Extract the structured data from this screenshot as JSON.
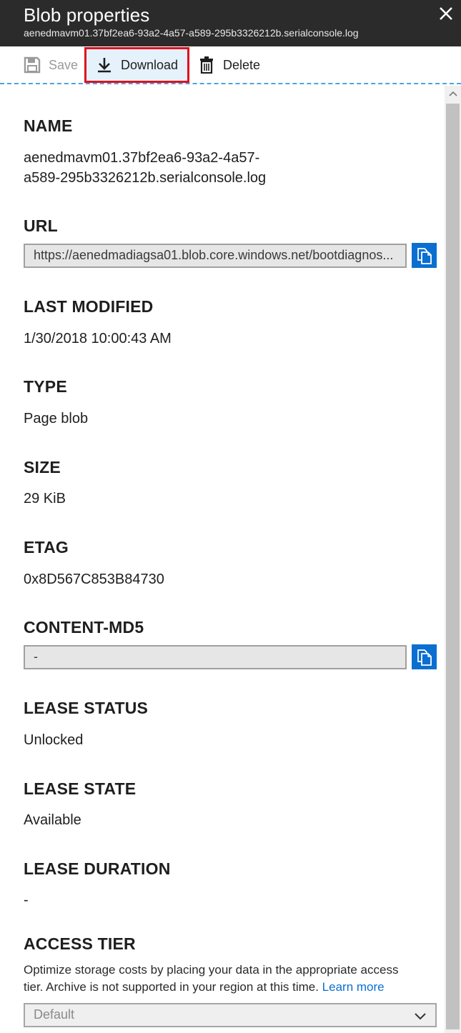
{
  "header": {
    "title": "Blob properties",
    "subtitle": "aenedmavm01.37bf2ea6-93a2-4a57-a589-295b3326212b.serialconsole.log"
  },
  "toolbar": {
    "save_label": "Save",
    "download_label": "Download",
    "delete_label": "Delete"
  },
  "properties": {
    "name": {
      "label": "NAME",
      "value_line1": "aenedmavm01.37bf2ea6-93a2-4a57-",
      "value_line2": "a589-295b3326212b.serialconsole.log"
    },
    "url": {
      "label": "URL",
      "value": "https://aenedmadiagsa01.blob.core.windows.net/bootdiagnos..."
    },
    "last_modified": {
      "label": "LAST MODIFIED",
      "value": "1/30/2018 10:00:43 AM"
    },
    "type": {
      "label": "TYPE",
      "value": "Page blob"
    },
    "size": {
      "label": "SIZE",
      "value": "29 KiB"
    },
    "etag": {
      "label": "ETAG",
      "value": "0x8D567C853B84730"
    },
    "content_md5": {
      "label": "CONTENT-MD5",
      "value": "-"
    },
    "lease_status": {
      "label": "LEASE STATUS",
      "value": "Unlocked"
    },
    "lease_state": {
      "label": "LEASE STATE",
      "value": "Available"
    },
    "lease_duration": {
      "label": "LEASE DURATION",
      "value": "-"
    },
    "access_tier": {
      "label": "ACCESS TIER",
      "description_line1": "Optimize storage costs by placing your data in the appropriate access",
      "description_line2": "tier. Archive is not supported in your region at this time.",
      "learn_more": "Learn more",
      "selected": "Default"
    }
  },
  "colors": {
    "header_bg": "#2b2b2b",
    "accent": "#0a6fd1",
    "highlight_border": "#e0101e"
  },
  "icons": [
    "close-icon",
    "save-icon",
    "download-icon",
    "delete-icon",
    "copy-icon",
    "chevron-down-icon",
    "scroll-up-icon"
  ]
}
